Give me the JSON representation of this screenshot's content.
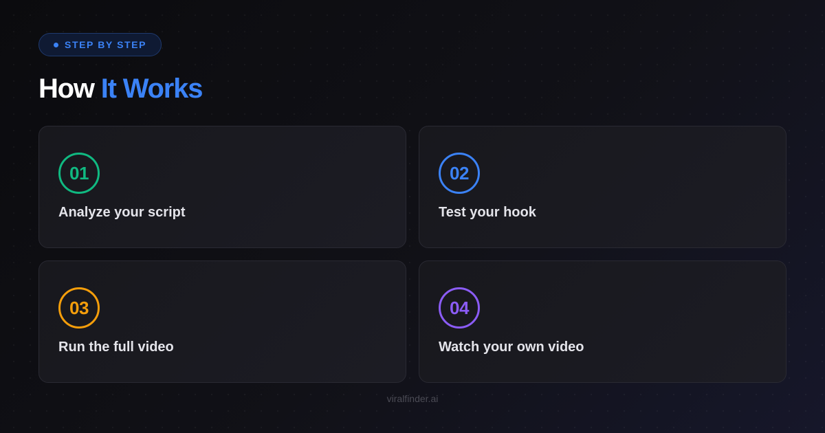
{
  "badge": {
    "label": "STEP BY STEP"
  },
  "heading": {
    "plain": "How",
    "accent": "It Works"
  },
  "steps": [
    {
      "number": "01",
      "title": "Analyze your script",
      "color": "#10b981"
    },
    {
      "number": "02",
      "title": "Test your hook",
      "color": "#3b82f6"
    },
    {
      "number": "03",
      "title": "Run the full video",
      "color": "#f59e0b"
    },
    {
      "number": "04",
      "title": "Watch your own video",
      "color": "#8b5cf6"
    }
  ],
  "footer": {
    "text": "viralfinder.ai"
  },
  "colors": {
    "accent": "#3b82f6",
    "background": "#0b0b0e",
    "card_background": "#18181d",
    "card_border": "#2a2a33"
  }
}
